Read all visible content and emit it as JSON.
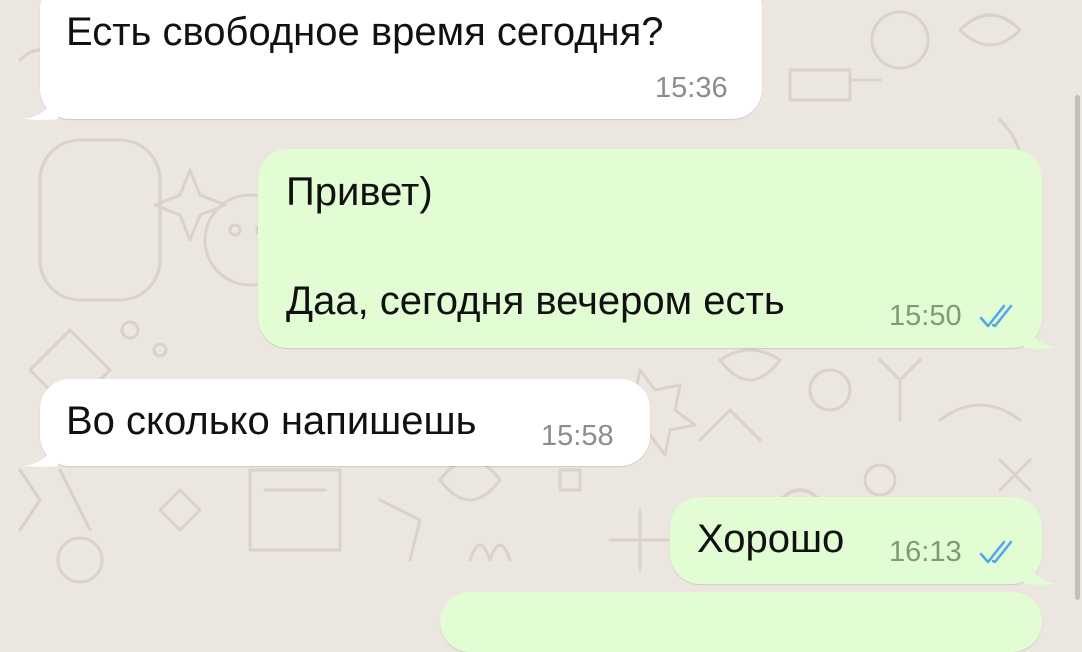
{
  "chat": {
    "messages": [
      {
        "direction": "incoming",
        "lines": [
          "Есть свободное время сегодня?"
        ],
        "time": "15:36"
      },
      {
        "direction": "outgoing",
        "lines": [
          "Привет)",
          "Даа, сегодня вечером есть"
        ],
        "time": "15:50",
        "status": "read"
      },
      {
        "direction": "incoming",
        "lines": [
          "Во сколько напишешь"
        ],
        "time": "15:58"
      },
      {
        "direction": "outgoing",
        "lines": [
          "Хорошо"
        ],
        "time": "16:13",
        "status": "read"
      }
    ]
  },
  "colors": {
    "background": "#ebe6df",
    "incoming_bubble": "#ffffff",
    "outgoing_bubble": "#e2fcd3",
    "read_ticks": "#4fa6e8"
  },
  "icons": {
    "read_receipt": "double-check-icon",
    "wallpaper": "doodle-wallpaper"
  }
}
